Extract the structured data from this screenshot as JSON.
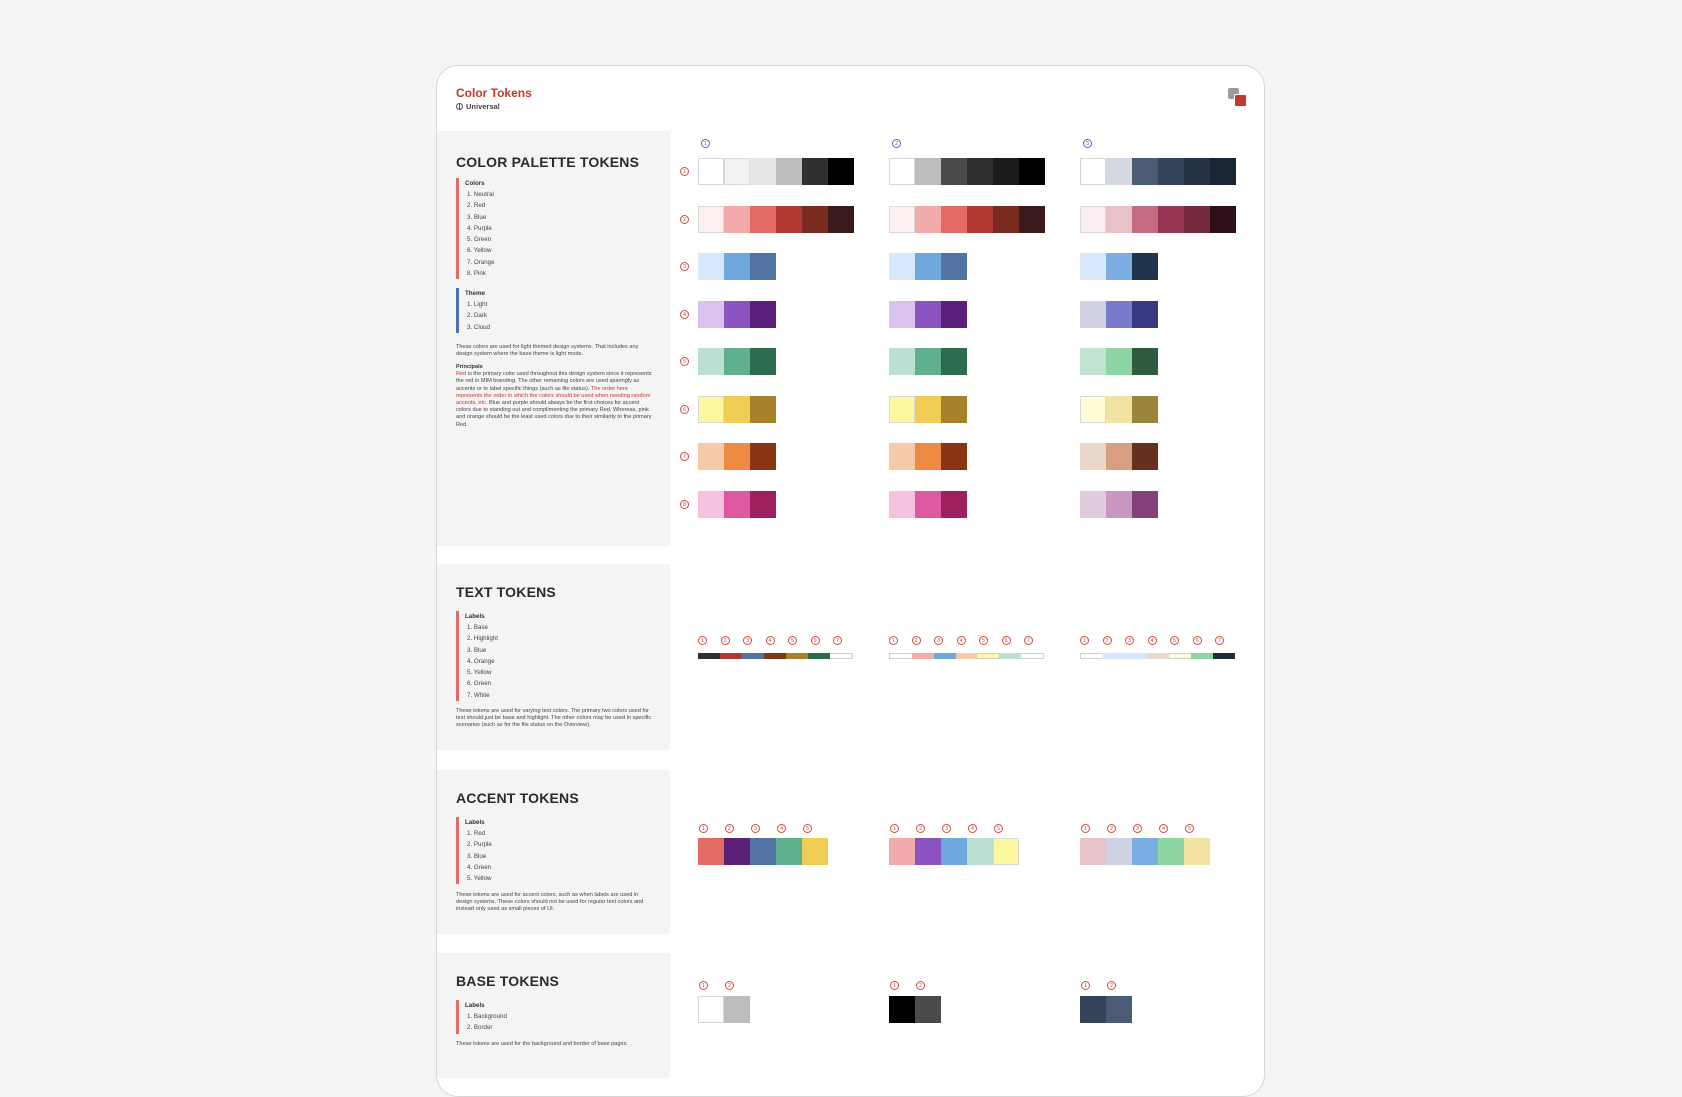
{
  "header": {
    "title": "Color Tokens",
    "subtitle": "Universal"
  },
  "sections": {
    "palette": {
      "title": "COLOR PALETTE TOKENS",
      "colors_title": "Colors",
      "colors": [
        "1. Neutral",
        "2. Red",
        "3. Blue",
        "4. Purple",
        "5. Green",
        "6. Yellow",
        "7. Orange",
        "8. Pink"
      ],
      "theme_title": "Theme",
      "themes": [
        "1. Light",
        "2. Dark",
        "3. Cloud"
      ],
      "desc": "These colors are used for light themed design systems. That includes any design system where the base theme is light mode.",
      "principles_title": "Principals",
      "principles_red_word": "Red",
      "principles_1": " is the primary color used throughout this design system since it represents the red in MIM branding. The other remaining colors are used sparingly as accents or to label specific things (such as file status). ",
      "principles_red_sentence": "The order here represents the order in which the colors should be used when needing random accents, etc.",
      "principles_2": " Blue and purple should always be the first choices for accent colors due to standing out and complimenting the primary Red. Whereas, pink and orange should be the least used colors due to their similarity to the primary Red."
    },
    "text": {
      "title": "TEXT TOKENS",
      "labels_title": "Labels",
      "labels": [
        "1. Base",
        "2. Highlight",
        "3. Blue",
        "4. Orange",
        "5. Yellow",
        "6. Green",
        "7. White"
      ],
      "desc": "These tokens are used for varying text colors. The primary two colors used for text should just be base and highlight. The other colors may be used in specific scenarios (such as for the file status on the Overview)."
    },
    "accent": {
      "title": "ACCENT TOKENS",
      "labels_title": "Labels",
      "labels": [
        "1. Red",
        "2. Purple",
        "3. Blue",
        "4. Green",
        "5. Yellow"
      ],
      "desc": "These tokens are used for accent colors, such as when labels are used in design systems. These colors should not be used for regular text colors and instead only used as small pieces of UI."
    },
    "base": {
      "title": "BASE TOKENS",
      "labels_title": "Labels",
      "labels": [
        "1. Background",
        "2.  Border"
      ],
      "desc": "These tokens are used for the background and border of base pages."
    }
  },
  "theme_markers": [
    "1",
    "2",
    "3"
  ],
  "row_markers": [
    "1",
    "2",
    "3",
    "4",
    "5",
    "6",
    "7",
    "8"
  ],
  "palette_swatches": [
    [
      [
        "#ffffff",
        "#f2f2f2",
        "#e6e6e6",
        "#bdbdbd",
        "#2f2f2f",
        "#000000"
      ],
      [
        "#fdf0f0",
        "#f2aaaa",
        "#e46a66",
        "#b03a32",
        "#7a2a1e",
        "#3a1a1a"
      ],
      [
        "#d6e8fb",
        "#6fa8dc",
        "#5174a3"
      ],
      [
        "#d9c3ee",
        "#8a53bf",
        "#5c1f7a"
      ],
      [
        "#b9e0d1",
        "#5fb08d",
        "#2c6b4c"
      ],
      [
        "#fdf7a0",
        "#f2cd56",
        "#a8822b"
      ],
      [
        "#f6c9a8",
        "#ef8a45",
        "#8a3414"
      ],
      [
        "#f4c1df",
        "#dd5aa0",
        "#a01f5e"
      ]
    ],
    [
      [
        "#ffffff",
        "#bdbdbd",
        "#4a4a4a",
        "#2f2f2f",
        "#1c1c1c",
        "#000000"
      ],
      [
        "#fdf0f0",
        "#f2aaaa",
        "#e46a66",
        "#b03a32",
        "#7a2a1e",
        "#3a1a1a"
      ],
      [
        "#d6e8fb",
        "#6fa8dc",
        "#5174a3"
      ],
      [
        "#d9c3ee",
        "#8a53bf",
        "#5c1f7a"
      ],
      [
        "#b9e0d1",
        "#5fb08d",
        "#2c6b4c"
      ],
      [
        "#fdf7a0",
        "#f2cd56",
        "#a8822b"
      ],
      [
        "#f6c9a8",
        "#ef8a45",
        "#8a3414"
      ],
      [
        "#f4c1df",
        "#dd5aa0",
        "#a01f5e"
      ]
    ],
    [
      [
        "#ffffff",
        "#d4d9e1",
        "#4b5b74",
        "#34435a",
        "#263345",
        "#1a2636"
      ],
      [
        "#fbeef0",
        "#e9c2c9",
        "#c46b7f",
        "#973552",
        "#742a3d",
        "#2f0f17"
      ],
      [
        "#d6e8fb",
        "#7aaee3",
        "#1e354c"
      ],
      [
        "#d1d1e4",
        "#7a7acc",
        "#3a3a82"
      ],
      [
        "#c2e3cf",
        "#8dd6a3",
        "#2f5c3e"
      ],
      [
        "#fffcd6",
        "#f3e3a2",
        "#9c853a"
      ],
      [
        "#ebd8cd",
        "#d89e82",
        "#653220"
      ],
      [
        "#dfcbde",
        "#c797c2",
        "#864079"
      ]
    ]
  ],
  "text_markers": [
    "1",
    "2",
    "3",
    "4",
    "5",
    "6",
    "7"
  ],
  "text_bars": [
    [
      "#2f2f2f",
      "#b03a32",
      "#5174a3",
      "#7a3a14",
      "#a8822b",
      "#2c6b4c",
      "#ffffff"
    ],
    [
      "#ffffff",
      "#f2aaaa",
      "#6fa8dc",
      "#f6c9a8",
      "#fdf7a0",
      "#b9e0d1",
      "#ffffff"
    ],
    [
      "#ffffff",
      "#d6e8fb",
      "#d6e8fb",
      "#ebd8cd",
      "#fffcd6",
      "#8dd6a3",
      "#1e2b3a"
    ]
  ],
  "accent_markers": [
    "1",
    "2",
    "3",
    "4",
    "5"
  ],
  "accent_swatches": [
    [
      "#e46a66",
      "#5c1f7a",
      "#5174a3",
      "#5fb08d",
      "#f2cd56"
    ],
    [
      "#f2aaaa",
      "#8a53bf",
      "#6fa8dc",
      "#b9e0d1",
      "#fdf7a0"
    ],
    [
      "#e9c2c9",
      "#d1d1e4",
      "#7aaee3",
      "#8dd6a3",
      "#f3e3a2"
    ]
  ],
  "base_markers": [
    "1",
    "2"
  ],
  "base_swatches": [
    [
      "#ffffff",
      "#bdbdbd"
    ],
    [
      "#000000",
      "#4a4a4a"
    ],
    [
      "#34435a",
      "#4b5b74"
    ]
  ],
  "colors": {
    "brand_red": "#c0392b",
    "theme_blue": "#4a6fb5",
    "marker_red": "#d14b42",
    "panel_bg": "#f4f4f4"
  }
}
